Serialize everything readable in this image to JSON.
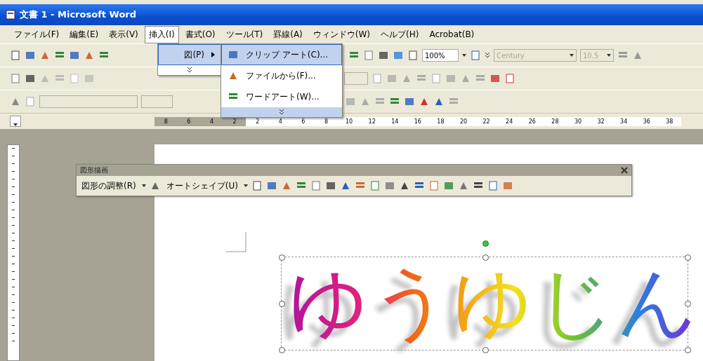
{
  "window": {
    "title": "文書 1 - Microsoft Word"
  },
  "menu_bar": [
    {
      "label": "ファイル(F)",
      "selected": false
    },
    {
      "label": "編集(E)",
      "selected": false
    },
    {
      "label": "表示(V)",
      "selected": false
    },
    {
      "label": "挿入(I)",
      "selected": true
    },
    {
      "label": "書式(O)",
      "selected": false
    },
    {
      "label": "ツール(T)",
      "selected": false
    },
    {
      "label": "罫線(A)",
      "selected": false
    },
    {
      "label": "ウィンドウ(W)",
      "selected": false
    },
    {
      "label": "ヘルプ(H)",
      "selected": false
    },
    {
      "label": "Acrobat(B)",
      "selected": false
    }
  ],
  "insert_menu": {
    "items": [
      {
        "label": "図(P)",
        "selected": true
      }
    ]
  },
  "picture_submenu": {
    "items": [
      {
        "label": "クリップ アート(C)...",
        "selected": true
      },
      {
        "label": "ファイルから(F)...",
        "selected": false
      },
      {
        "label": "ワードアート(W)...",
        "selected": false
      }
    ]
  },
  "standard_toolbar": {
    "zoom": "100%",
    "font": "Century",
    "font_size": "10.5"
  },
  "ruler": {
    "ticks": [
      {
        "label": "8",
        "kind": "margin"
      },
      {
        "label": "6",
        "kind": "margin"
      },
      {
        "label": "4",
        "kind": "margin"
      },
      {
        "label": "2",
        "kind": "margin"
      },
      {
        "label": "2",
        "kind": "text"
      },
      {
        "label": "4",
        "kind": "text"
      },
      {
        "label": "6",
        "kind": "text"
      },
      {
        "label": "8",
        "kind": "text"
      },
      {
        "label": "10",
        "kind": "text"
      },
      {
        "label": "12",
        "kind": "text"
      },
      {
        "label": "14",
        "kind": "text"
      },
      {
        "label": "16",
        "kind": "text"
      },
      {
        "label": "18",
        "kind": "text"
      },
      {
        "label": "20",
        "kind": "text"
      },
      {
        "label": "22",
        "kind": "text"
      },
      {
        "label": "24",
        "kind": "text"
      },
      {
        "label": "26",
        "kind": "text"
      },
      {
        "label": "28",
        "kind": "text"
      },
      {
        "label": "30",
        "kind": "text"
      },
      {
        "label": "32",
        "kind": "text"
      },
      {
        "label": "34",
        "kind": "text"
      },
      {
        "label": "36",
        "kind": "text"
      },
      {
        "label": "38",
        "kind": "text"
      }
    ]
  },
  "drawing_toolbar": {
    "title": "図形描画",
    "draw_menu": "図形の調整(R)",
    "autoshapes_menu": "オートシェイプ(U)"
  },
  "wordart": {
    "text": "ゆうゆじん",
    "selected": true
  }
}
